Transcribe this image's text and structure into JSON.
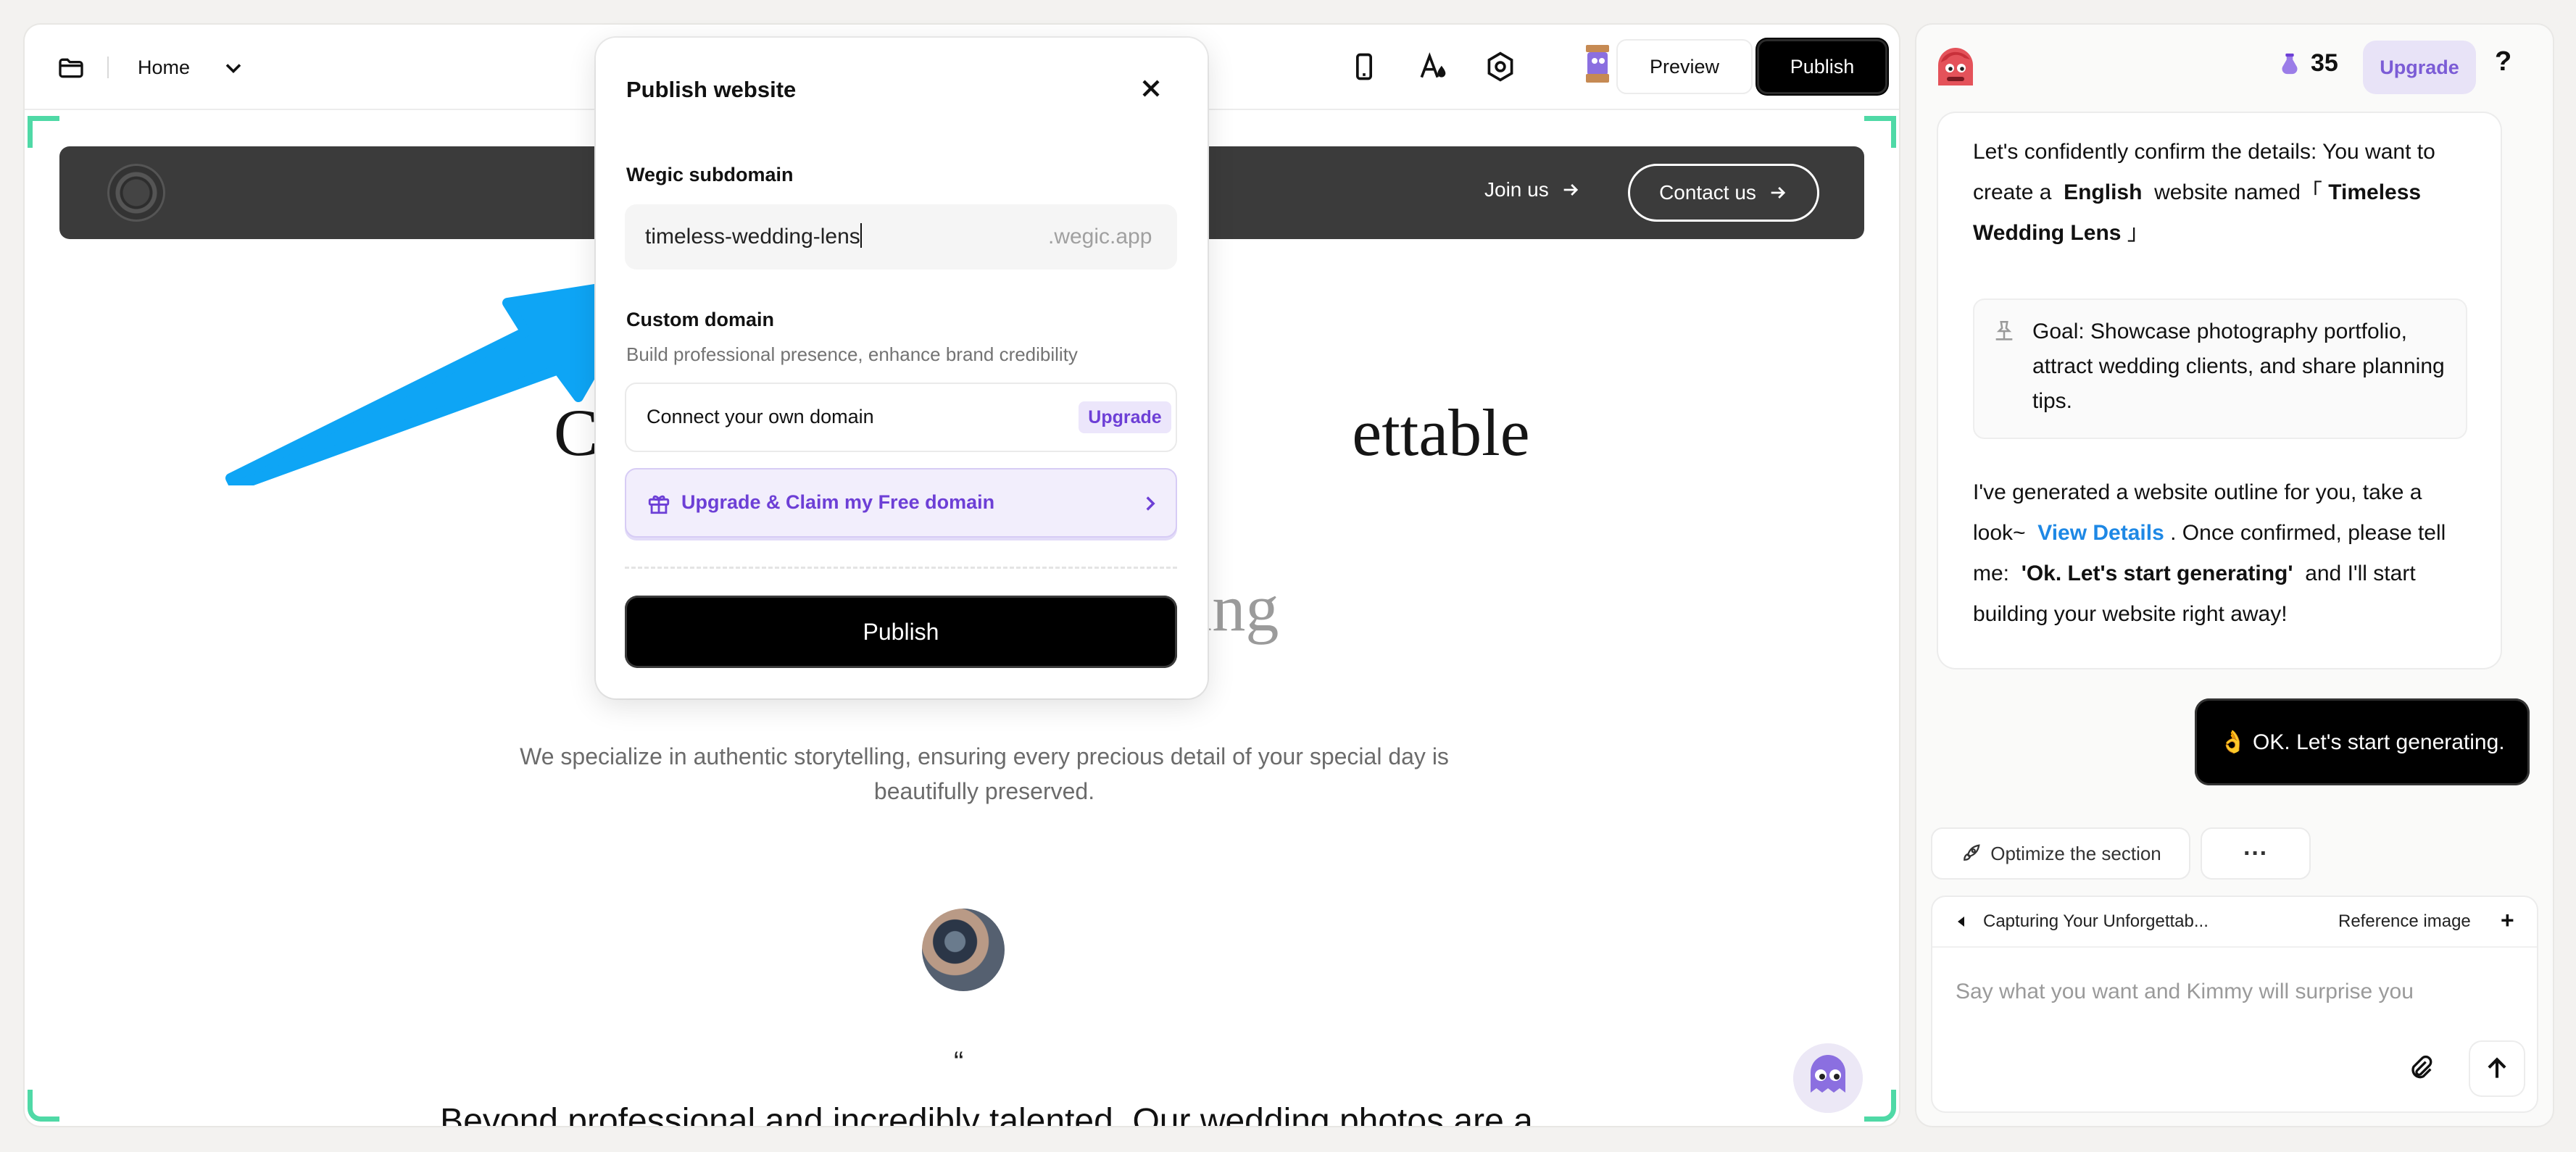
{
  "editor": {
    "page_selector": "Home",
    "toolbar": {
      "preview_label": "Preview",
      "publish_label": "Publish"
    },
    "icons": [
      "folder-icon",
      "chevron-down-icon",
      "mobile-icon",
      "typography-icon",
      "settings-icon",
      "character-icon"
    ]
  },
  "site": {
    "nav": {
      "join_label": "Join us",
      "contact_label": "Contact us"
    },
    "hero_title_visible": [
      "C",
      "ettable"
    ],
    "hero_sub_visible": [
      "“",
      "dding"
    ],
    "description": "We specialize in authentic storytelling, ensuring every precious detail of your special day is beautifully preserved.",
    "quote_mark": "“",
    "testimonial": "Beyond professional and incredibly talented. Our wedding photos are a"
  },
  "modal": {
    "title": "Publish website",
    "subdomain_label": "Wegic subdomain",
    "subdomain_value": "timeless-wedding-lens",
    "subdomain_suffix": ".wegic.app",
    "custom_domain_label": "Custom domain",
    "custom_domain_desc": "Build professional presence, enhance brand credibility",
    "connect_label": "Connect your own domain",
    "upgrade_badge": "Upgrade",
    "claim_label": "Upgrade & Claim my Free domain",
    "publish_label": "Publish"
  },
  "chat": {
    "credits": "35",
    "upgrade_label": "Upgrade",
    "help_label": "?",
    "message": {
      "intro_pre": "Let's confidently confirm the details: You want to create a",
      "language": "English",
      "intro_mid": "website named「",
      "site_name": "Timeless Wedding Lens",
      "intro_end": "」",
      "goal": "Goal: Showcase photography portfolio, attract wedding clients, and share planning tips.",
      "outline_pre": "I've generated a website outline for you, take a look~",
      "view_details": "View Details",
      "outline_mid": ". Once confirmed, please tell me:",
      "command": "'Ok. Let's start generating'",
      "outline_end": "and I'll start building your website right away!"
    },
    "user_message": "👌 OK. Let's start generating.",
    "actions": {
      "optimize_label": "Optimize the section",
      "more_label": "···"
    },
    "composer": {
      "context_label": "Capturing Your Unforgettab...",
      "reference_label": "Reference image",
      "add_label": "+",
      "placeholder": "Say what you want and Kimmy will surprise you"
    }
  },
  "colors": {
    "accent_purple": "#6d3fd6",
    "link_blue": "#1e88e5",
    "arrow_blue": "#0ea5f5",
    "frame_green": "#4fd9a6"
  }
}
